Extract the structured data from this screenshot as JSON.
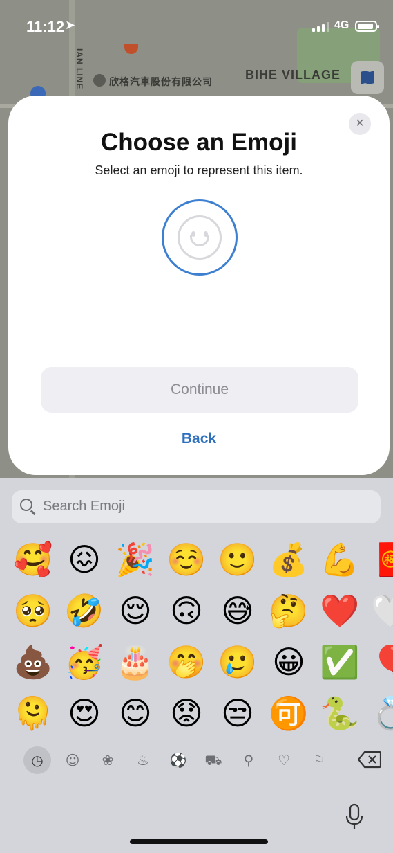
{
  "status_bar": {
    "time": "11:12",
    "network": "4G"
  },
  "map": {
    "village_label": "BIHE VILLAGE",
    "company_label": "欣格汽車股份有限公司",
    "road_label": "IAN LINE"
  },
  "modal": {
    "title": "Choose an Emoji",
    "subtitle": "Select an emoji to represent this item.",
    "close_label": "×",
    "continue_label": "Continue",
    "back_label": "Back",
    "colors": {
      "accent": "#2e6fbe",
      "circle_border": "#3d7fd0"
    }
  },
  "keyboard": {
    "search_placeholder": "Search Emoji",
    "emoji_rows": [
      [
        "🥰",
        "😖",
        "🎉",
        "☺️",
        "🙂",
        "💰",
        "💪",
        "🧧"
      ],
      [
        "🥺",
        "🤣",
        "😌",
        "🙃",
        "😅",
        "🤔",
        "❤️",
        "🤍"
      ],
      [
        "💩",
        "🥳",
        "🎂",
        "🤭",
        "🥲",
        "😀",
        "✅",
        "🎈"
      ],
      [
        "🫠",
        "😍",
        "😊",
        "😟",
        "😒",
        "🉑",
        "🐍",
        "💍"
      ]
    ],
    "categories": [
      {
        "icon": "clock-icon",
        "glyph": "◷",
        "selected": true
      },
      {
        "icon": "smiley-icon",
        "glyph": "☺"
      },
      {
        "icon": "animal-icon",
        "glyph": "❀"
      },
      {
        "icon": "food-icon",
        "glyph": "♨"
      },
      {
        "icon": "activity-icon",
        "glyph": "⚽"
      },
      {
        "icon": "travel-icon",
        "glyph": "⛟"
      },
      {
        "icon": "objects-icon",
        "glyph": "⚲"
      },
      {
        "icon": "symbols-icon",
        "glyph": "♡"
      },
      {
        "icon": "flags-icon",
        "glyph": "⚐"
      }
    ]
  }
}
